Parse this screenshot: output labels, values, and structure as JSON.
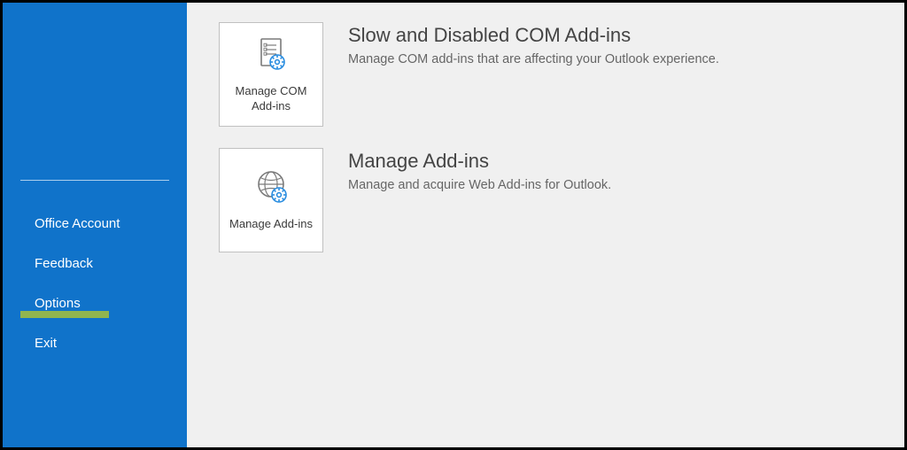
{
  "sidebar": {
    "items": [
      {
        "label": "Office Account"
      },
      {
        "label": "Feedback"
      },
      {
        "label": "Options"
      },
      {
        "label": "Exit"
      }
    ]
  },
  "content": {
    "tiles": [
      {
        "button_label": "Manage COM Add-ins",
        "title": "Slow and Disabled COM Add-ins",
        "subtitle": "Manage COM add-ins that are affecting your Outlook experience."
      },
      {
        "button_label": "Manage Add-ins",
        "title": "Manage Add-ins",
        "subtitle": "Manage and acquire Web Add-ins for Outlook."
      }
    ]
  }
}
